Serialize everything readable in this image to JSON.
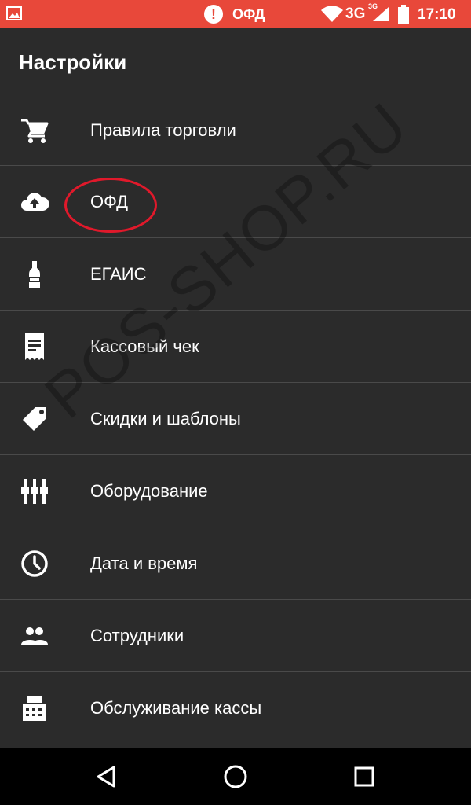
{
  "status_bar": {
    "notification_label": "ОФД",
    "network": "3G",
    "network_small": "3G",
    "time": "17:10",
    "icons": [
      "image-icon",
      "alert-icon",
      "wifi-icon",
      "signal-icon",
      "battery-icon"
    ]
  },
  "header": {
    "title": "Настройки"
  },
  "menu": {
    "items": [
      {
        "label": "Правила торговли",
        "icon": "cart-icon"
      },
      {
        "label": "ОФД",
        "icon": "cloud-upload-icon"
      },
      {
        "label": "ЕГАИС",
        "icon": "bottle-icon"
      },
      {
        "label": "Кассовый чек",
        "icon": "receipt-icon"
      },
      {
        "label": "Скидки и шаблоны",
        "icon": "tag-icon"
      },
      {
        "label": "Оборудование",
        "icon": "equipment-icon"
      },
      {
        "label": "Дата и время",
        "icon": "clock-icon"
      },
      {
        "label": "Сотрудники",
        "icon": "people-icon"
      },
      {
        "label": "Обслуживание кассы",
        "icon": "cash-register-icon"
      }
    ]
  },
  "watermark": "POS-SHOP.RU",
  "colors": {
    "status_bar": "#e8483a",
    "background": "#2b2b2b",
    "divider": "#4a4a4a",
    "highlight_circle": "#e0192b",
    "nav_bar": "#000000"
  }
}
